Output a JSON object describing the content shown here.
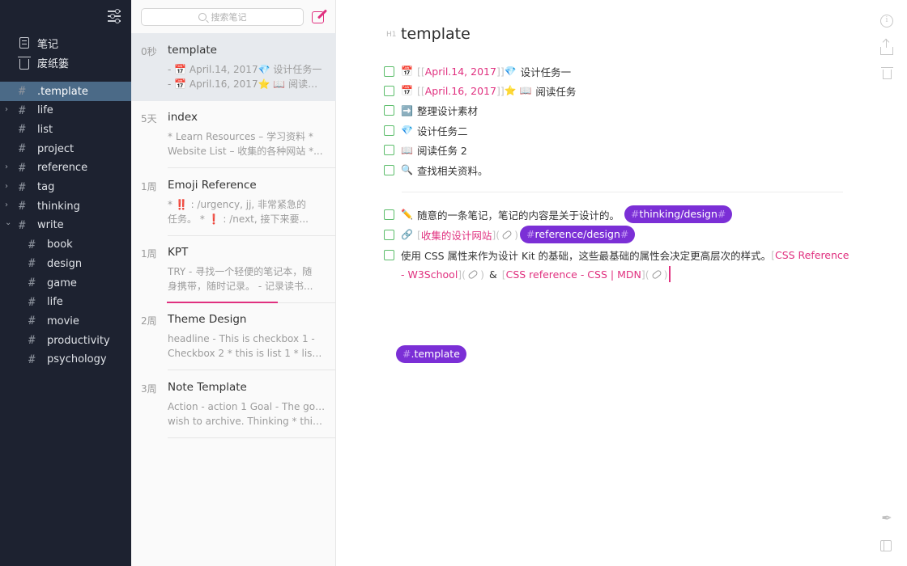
{
  "sidebar": {
    "fixed": [
      {
        "label": "笔记",
        "icon": "note-icon"
      },
      {
        "label": "废纸篓",
        "icon": "trash-icon"
      }
    ],
    "tags": [
      {
        "label": ".template",
        "active": true,
        "expandable": false,
        "level": 0
      },
      {
        "label": "life",
        "expandable": true,
        "level": 0
      },
      {
        "label": "list",
        "expandable": false,
        "level": 0
      },
      {
        "label": "project",
        "expandable": false,
        "level": 0
      },
      {
        "label": "reference",
        "expandable": true,
        "level": 0
      },
      {
        "label": "tag",
        "expandable": true,
        "level": 0
      },
      {
        "label": "thinking",
        "expandable": true,
        "level": 0
      },
      {
        "label": "write",
        "expanded": true,
        "level": 0
      },
      {
        "label": "book",
        "level": 1
      },
      {
        "label": "design",
        "level": 1
      },
      {
        "label": "game",
        "level": 1
      },
      {
        "label": "life",
        "level": 1
      },
      {
        "label": "movie",
        "level": 1
      },
      {
        "label": "productivity",
        "level": 1
      },
      {
        "label": "psychology",
        "level": 1
      }
    ]
  },
  "list": {
    "search_placeholder": "搜索笔记",
    "notes": [
      {
        "age": "0秒",
        "title": "template",
        "line1": "- 📅 April.14, 2017💎 设计任务一",
        "line2": "- 📅 April.16, 2017⭐ 📖 阅读任务...",
        "active": true
      },
      {
        "age": "5天",
        "title": "index",
        "line1": "* Learn Resources – 学习资料 *",
        "line2": "Website List – 收集的各种网站 *..."
      },
      {
        "age": "1周",
        "title": "Emoji Reference",
        "line1": "* ‼️ : /urgency, jj, 非常紧急的",
        "line2": "任务。 * ❗ : /next, 接下来要..."
      },
      {
        "age": "1周",
        "title": "KPT",
        "line1": "TRY - 寻找一个轻便的笔记本，随",
        "line2": "身携带，随时记录。 - 记录读书..."
      },
      {
        "age": "2周",
        "title": "Theme Design",
        "line1": "headline - This is checkbox 1 -",
        "line2": "Checkbox 2 * this is list 1 * list 2..."
      },
      {
        "age": "3周",
        "title": "Note Template",
        "line1": "Action - action 1 Goal - The goal I",
        "line2": "wish to archive. Thinking * think..."
      }
    ],
    "sync_progress": 0.58
  },
  "editor": {
    "heading_marker": "H1",
    "title": "template",
    "tasks1": [
      {
        "emoji": "📅",
        "open": "[[",
        "date": "April.14, 2017",
        "close": "]]",
        "emoji2": "💎",
        "text": "设计任务一"
      },
      {
        "emoji": "📅",
        "open": "[[",
        "date": "April.16, 2017",
        "close": "]]",
        "emoji2": "⭐ 📖",
        "text": "阅读任务"
      },
      {
        "emoji": "➡️",
        "text": "整理设计素材"
      },
      {
        "emoji": "💎",
        "text": "设计任务二"
      },
      {
        "emoji": "📖",
        "text": "阅读任务 2"
      },
      {
        "emoji": "🔍",
        "text": "查找相关资料。"
      }
    ],
    "task_a": {
      "emoji": "✏️",
      "text": "随意的一条笔记，笔记的内容是关于设计的。",
      "tag": "thinking/design"
    },
    "task_b": {
      "emoji": "🔗",
      "open": "[",
      "link": "收集的设计网站",
      "close": "](",
      "close2": ")",
      "tag": "reference/design"
    },
    "task_c": {
      "text": "使用 CSS 属性来作为设计 Kit 的基础，这些最基础的属性会决定更高层次的样式。",
      "open": "[",
      "link1a": "CSS Reference",
      "link1b": "- W3School",
      "close": "](",
      "close2": ")",
      "amp": "&",
      "link2": "CSS reference - CSS | MDN"
    },
    "note_tag": ".template"
  },
  "toolbar_icons": [
    "info-icon",
    "share-icon",
    "trash-icon",
    "pen-icon",
    "panel-icon"
  ],
  "colors": {
    "sidebar_bg": "#1d2230",
    "accent": "#e0307f",
    "tag_bg": "#7b2fd6",
    "checkbox": "#5cbd6b",
    "active_tag": "#4b6a87"
  }
}
